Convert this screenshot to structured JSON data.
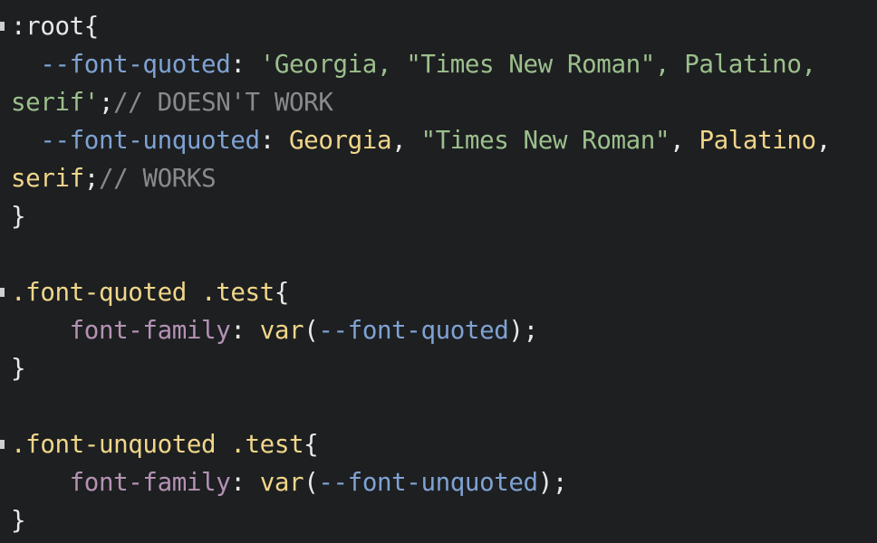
{
  "theme": {
    "background": "#1d1f21",
    "default_text": "#e8e8e8",
    "variable": "#7fa2d2",
    "string": "#9cbf8c",
    "comment": "#8a8a8a",
    "value": "#f0d68a",
    "property": "#b492b4"
  },
  "code": {
    "l1": {
      "selector": ":root",
      "brace": "{"
    },
    "l2": {
      "indent": "  ",
      "var": "--font-quoted",
      "colon": ": ",
      "string": "'Georgia, \"Times New Roman\", Palatino,"
    },
    "l3": {
      "string": "serif'",
      "semi": ";",
      "comment": "// DOESN'T WORK"
    },
    "l4": {
      "indent": "  ",
      "var": "--font-unquoted",
      "colon": ": ",
      "v1": "Georgia",
      "sep1": ", ",
      "str1": "\"Times New Roman\"",
      "sep2": ", ",
      "v2": "Palatino",
      "sep3": ","
    },
    "l5": {
      "value": "serif",
      "semi": ";",
      "comment": "// WORKS"
    },
    "l6": {
      "brace": "}"
    },
    "l8": {
      "selector": ".font-quoted .test",
      "brace": "{"
    },
    "l9": {
      "indent": "    ",
      "prop": "font-family",
      "colon": ": ",
      "func": "var",
      "open": "(",
      "var": "--font-quoted",
      "close": ");"
    },
    "l10": {
      "brace": "}"
    },
    "l12": {
      "selector": ".font-unquoted .test",
      "brace": "{"
    },
    "l13": {
      "indent": "    ",
      "prop": "font-family",
      "colon": ": ",
      "func": "var",
      "open": "(",
      "var": "--font-unquoted",
      "close": ");"
    },
    "l14": {
      "brace": "}"
    }
  }
}
